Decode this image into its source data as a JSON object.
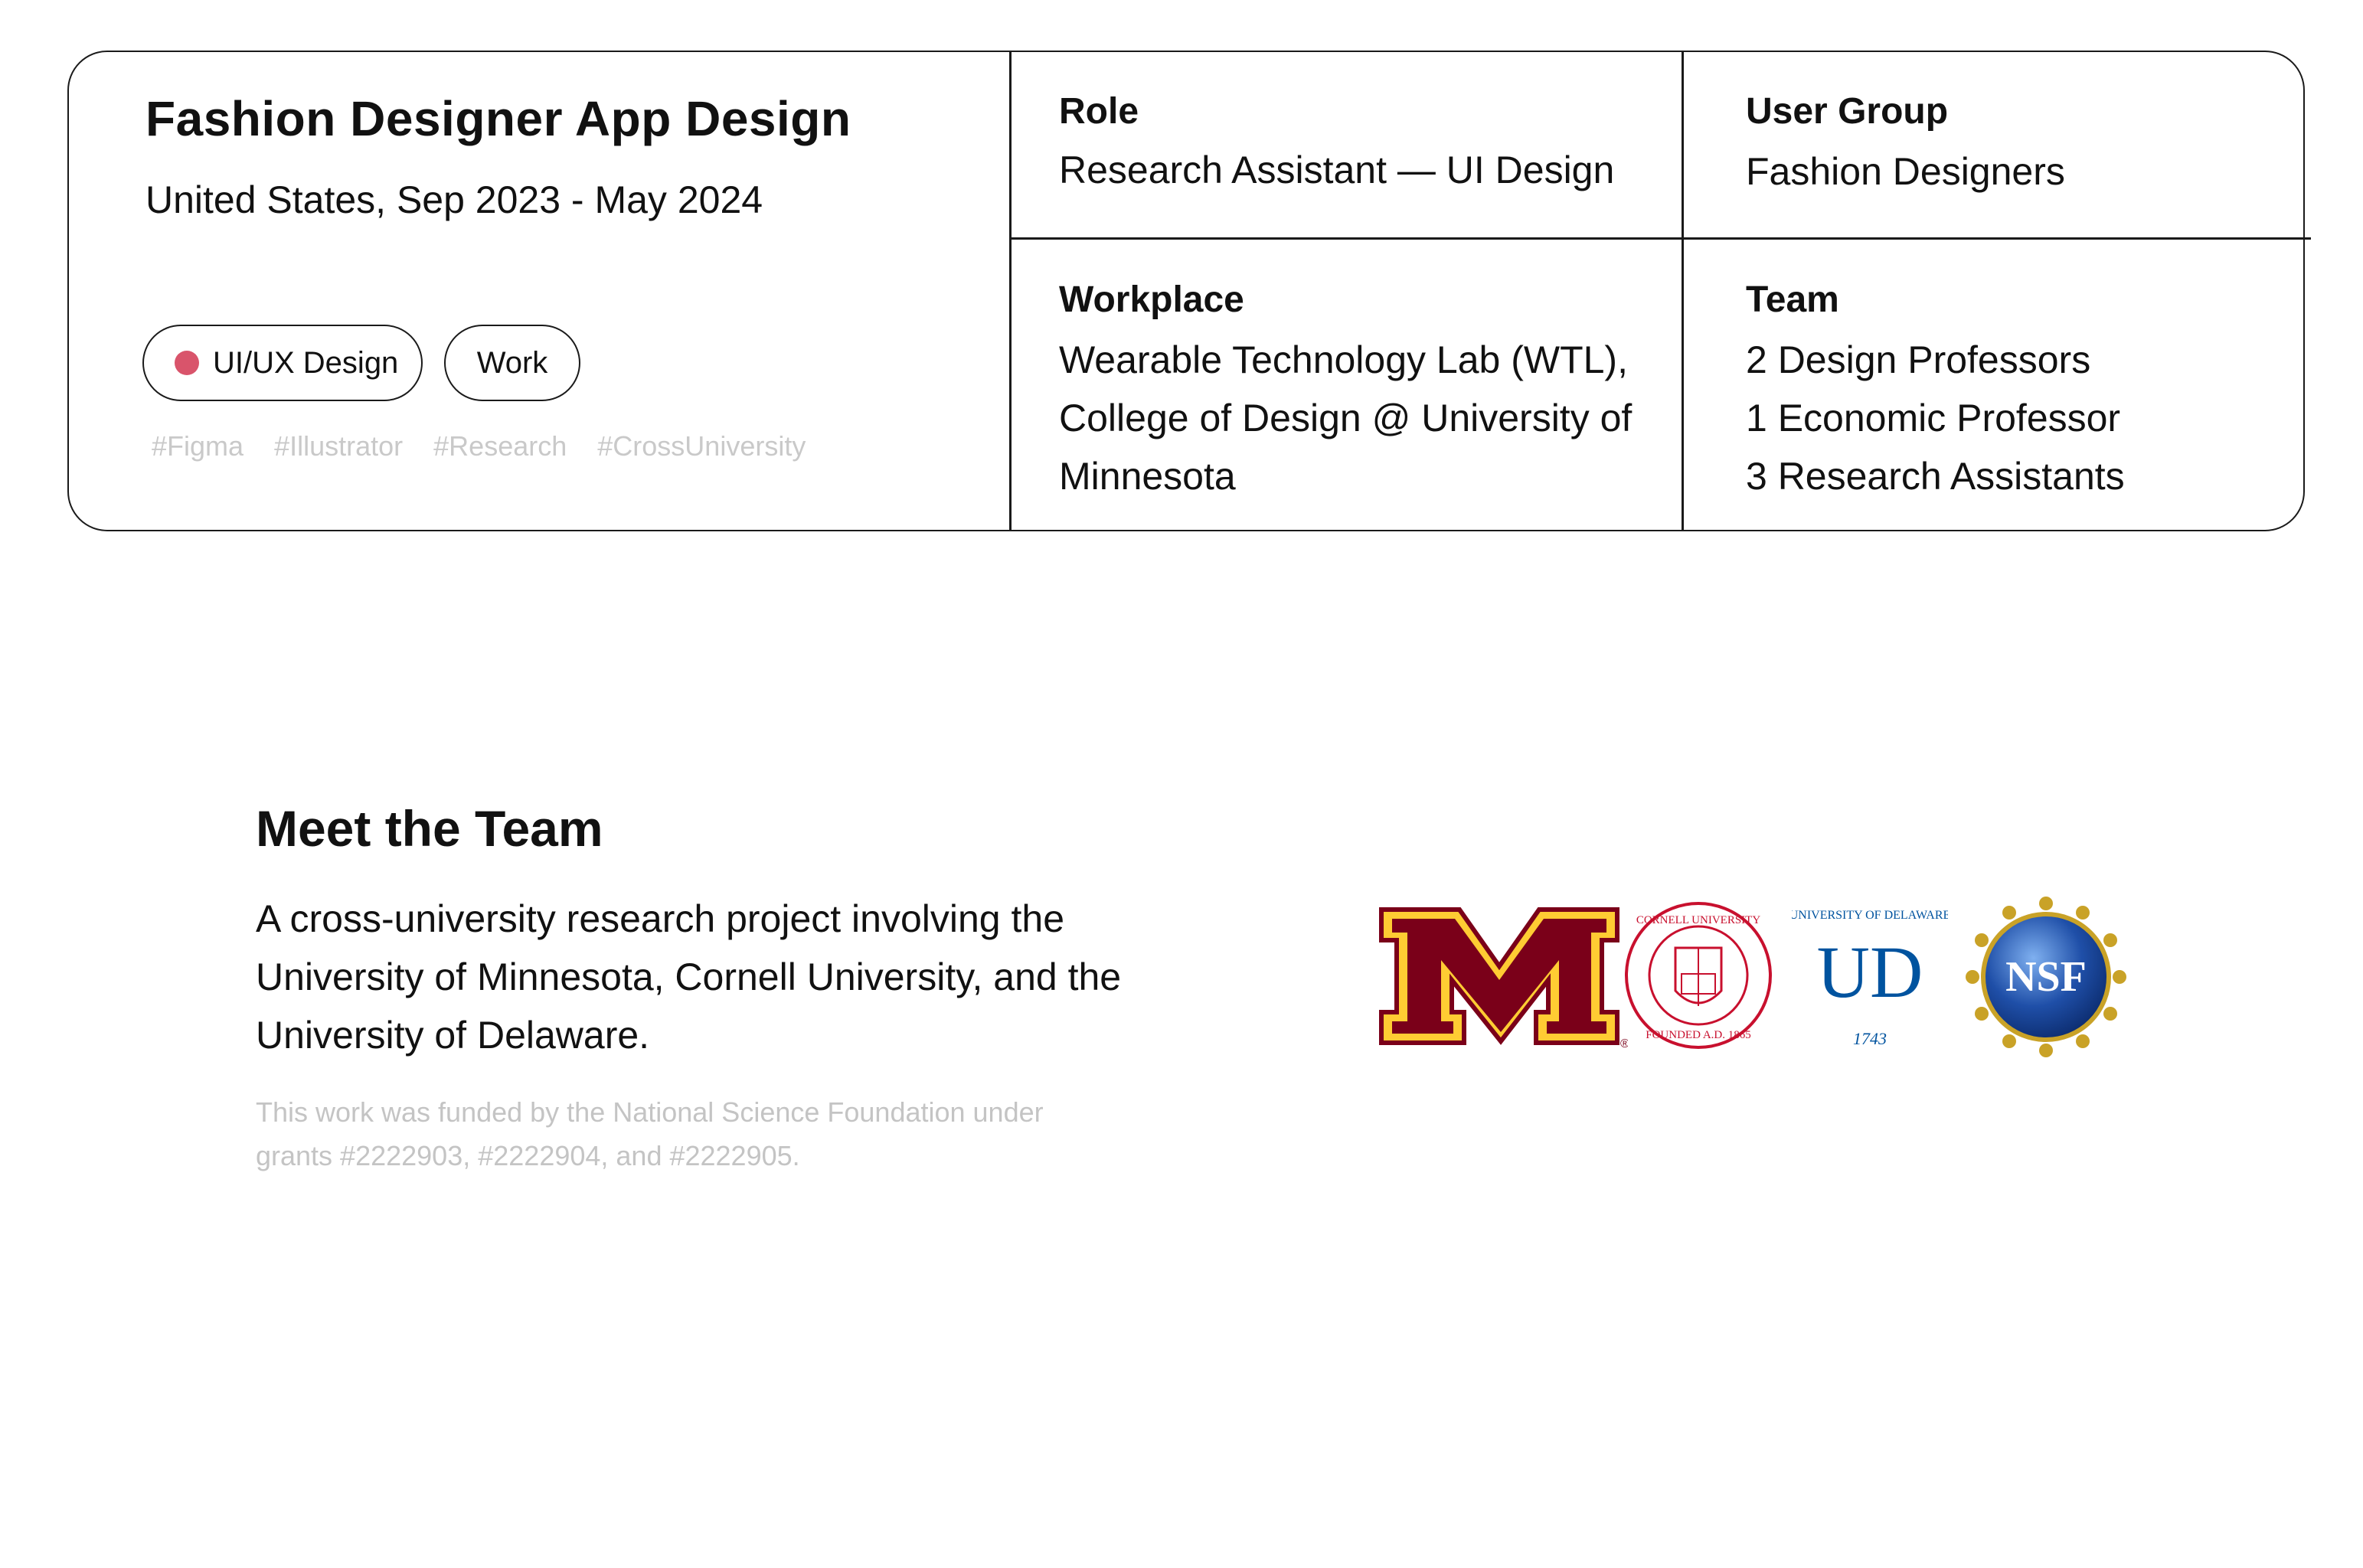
{
  "project": {
    "title": "Fashion Designer App Design",
    "subtitle": "United States, Sep 2023 - May 2024",
    "pills": [
      {
        "label": "UI/UX Design",
        "dot_color": "#d9546b"
      },
      {
        "label": "Work"
      }
    ],
    "tags": [
      "#Figma",
      "#Illustrator",
      "#Research",
      "#CrossUniversity"
    ]
  },
  "info": {
    "role": {
      "label": "Role",
      "value": "Research Assistant — UI Design"
    },
    "user_group": {
      "label": "User Group",
      "value": "Fashion Designers"
    },
    "workplace": {
      "label": "Workplace",
      "lines": [
        "Wearable Technology Lab (WTL),",
        "College of Design @ University of",
        "Minnesota"
      ]
    },
    "team": {
      "label": "Team",
      "lines": [
        "2 Design Professors",
        "1 Economic Professor",
        "3 Research Assistants"
      ]
    }
  },
  "meet": {
    "title": "Meet the Team",
    "body_lines": [
      "A cross-university research project involving the",
      "University of Minnesota, Cornell University, and the",
      "University of Delaware."
    ],
    "footnote_lines": [
      "This work was funded by the National Science Foundation under",
      "grants #2222903, #2222904, and #2222905."
    ]
  },
  "logos": [
    {
      "icon": "university-of-minnesota-logo",
      "text": "M",
      "registered": "®",
      "color": "#7a0019",
      "accent": "#ffcc33"
    },
    {
      "icon": "cornell-university-seal",
      "ring_top": "CORNELL UNIVERSITY",
      "ring_bottom": "FOUNDED A.D. 1865",
      "color": "#c8102e"
    },
    {
      "icon": "university-of-delaware-seal",
      "ring_top": "UNIVERSITY OF DELAWARE",
      "mark": "UD",
      "year": "1743",
      "color": "#00539f"
    },
    {
      "icon": "nsf-logo",
      "text": "NSF",
      "color": "#1f4fa8",
      "accent": "#c9a227"
    }
  ]
}
